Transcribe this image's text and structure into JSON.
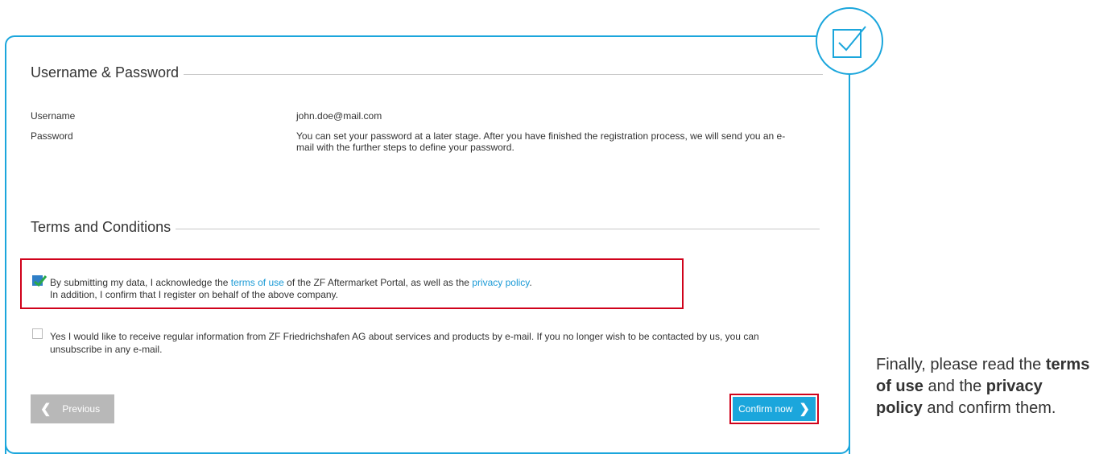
{
  "account": {
    "heading": "Username & Password",
    "username_label": "Username",
    "username_value": "john.doe@mail.com",
    "password_label": "Password",
    "password_text_line1": "You can set your password at a later stage. After you have finished the registration process, we will send you an e-",
    "password_text_line2": "mail with the further steps to define your password."
  },
  "terms": {
    "heading": "Terms and Conditions",
    "ack_prefix": "By submitting my data, I acknowledge the ",
    "terms_link": "terms of use",
    "ack_middle": " of the ZF Aftermarket Portal, as well as the ",
    "privacy_link": "privacy policy",
    "ack_suffix": ".",
    "ack_line2": "In addition, I confirm that I register on behalf of the above company.",
    "ack_checked": true,
    "newsletter_line1": "Yes I would like to receive regular information from ZF Friedrichshafen AG about services and products by e-mail. If you no longer wish to be contacted by us, you can",
    "newsletter_line2": "unsubscribe in any e-mail.",
    "newsletter_checked": false
  },
  "buttons": {
    "previous_label": "Previous",
    "confirm_label": "Confirm now"
  },
  "note": {
    "part1": "Finally, please read the ",
    "bold1": "terms of use",
    "part2": " and the ",
    "bold2": "privacy policy",
    "part3": " and confirm them."
  },
  "icons": {
    "badge": "check-square-icon",
    "prev": "chevron-left-icon",
    "next": "chevron-right-icon"
  },
  "colors": {
    "accent": "#1ba6dc",
    "highlight": "#d0021b",
    "link": "#1a9ad6",
    "disabled_button": "#b8b8b8"
  }
}
